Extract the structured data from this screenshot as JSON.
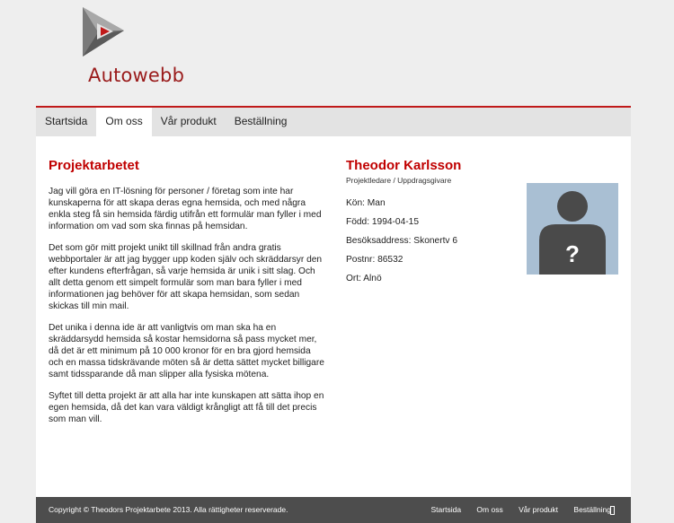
{
  "brand": {
    "name": "Autowebb",
    "accent": "#c00000",
    "logo_icon": "triangle-play-logo"
  },
  "nav": {
    "items": [
      {
        "label": "Startsida",
        "active": false
      },
      {
        "label": "Om oss",
        "active": true
      },
      {
        "label": "Vår produkt",
        "active": false
      },
      {
        "label": "Beställning",
        "active": false
      }
    ]
  },
  "main": {
    "heading": "Projektarbetet",
    "paragraphs": [
      "Jag vill göra en IT-lösning för personer / företag som inte har kunskaperna för att skapa deras egna hemsida, och med några enkla steg få sin hemsida färdig utifrån ett formulär man fyller i med information om vad som ska finnas på hemsidan.",
      "Det som gör mitt projekt unikt till skillnad från andra gratis webbportaler är att jag bygger upp koden själv och skräddarsyr den efter kundens efterfrågan, så varje hemsida är unik i sitt slag. Och allt detta genom ett simpelt formulär som man bara fyller i med informationen jag behöver för att skapa hemsidan, som sedan skickas till min mail.",
      "Det unika i denna ide är att vanligtvis om man ska ha en skräddarsydd hemsida så kostar hemsidorna så pass mycket mer, då det är ett minimum på 10 000 kronor för en bra gjord hemsida och en massa tidskrävande möten så är detta sättet mycket billigare samt tidssparande då man slipper alla fysiska mötena.",
      "Syftet till detta projekt är att alla har inte kunskapen att sätta ihop en egen hemsida, då det kan vara väldigt krångligt att få till det precis som man vill."
    ]
  },
  "person": {
    "name": "Theodor Karlsson",
    "role": "Projektledare / Uppdragsgivare",
    "info": [
      "Kön: Man",
      "Född: 1994-04-15",
      "Besöksaddress: Skonertv 6",
      "Postnr: 86532",
      "Ort: Alnö"
    ],
    "avatar_icon": "unknown-person-icon",
    "avatar_mark": "?"
  },
  "footer": {
    "copyright": "Copyright © Theodors Projektarbete 2013. Alla rättigheter reserverade.",
    "links": [
      "Startsida",
      "Om oss",
      "Vår produkt",
      "Beställning"
    ]
  }
}
